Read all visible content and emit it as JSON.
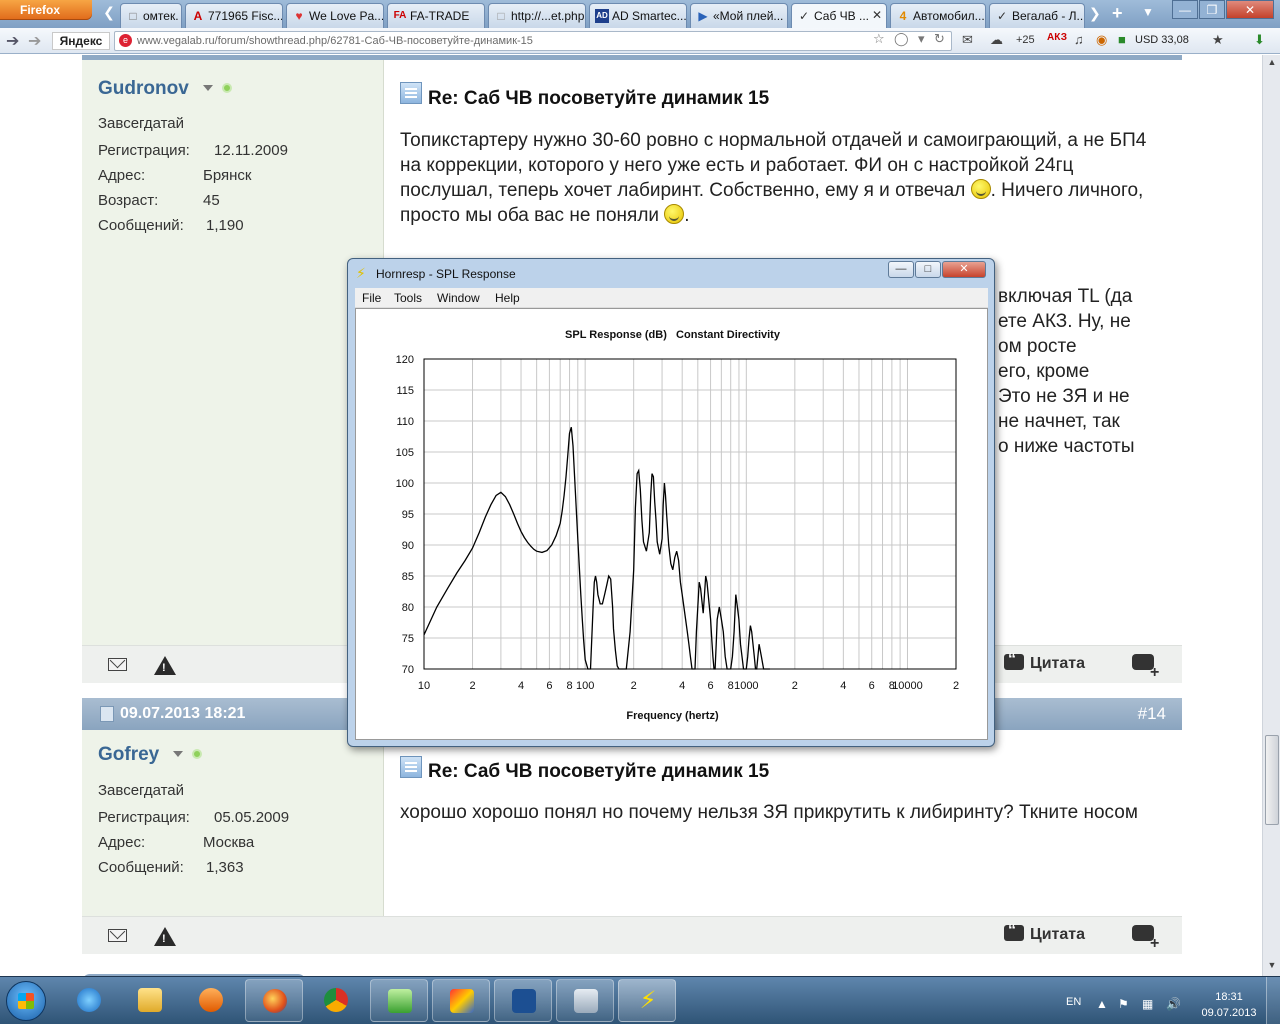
{
  "browser": {
    "firefox_label": "Firefox",
    "tabs": [
      {
        "label": "омтек. Ин...",
        "icon": "page-icon"
      },
      {
        "label": "771965 Fisc...",
        "icon": "letter-a-icon"
      },
      {
        "label": "We Love Pa...",
        "icon": "flame-icon"
      },
      {
        "label": "FA-TRADE",
        "icon": "fa-logo-icon"
      },
      {
        "label": "http://...et.php",
        "icon": "blank-page-icon"
      },
      {
        "label": "AD Smartec...",
        "icon": "ad-logo-icon"
      },
      {
        "label": "«Мой плей...",
        "icon": "play-icon"
      },
      {
        "label": "Саб ЧВ ...",
        "icon": "vega-icon"
      },
      {
        "label": "Автомобил...",
        "icon": "number-4-icon"
      },
      {
        "label": "Вегалаб - Л...",
        "icon": "vega-icon"
      }
    ],
    "yandex_label": "Яндекс",
    "url": "www.vegalab.ru/forum/showthread.php/62781-Саб-ЧВ-посоветуйте-динамик-15",
    "weather": "+25",
    "currency": "USD 33,08"
  },
  "posts": [
    {
      "username": "Gudronov",
      "usertitle": "Завсегдатай",
      "rows": [
        {
          "label": "Регистрация:",
          "value": "12.11.2009"
        },
        {
          "label": "Адрес:",
          "value": "Брянск"
        },
        {
          "label": "Возраст:",
          "value": "45"
        },
        {
          "label": "Сообщений:",
          "value": "1,190"
        }
      ],
      "title": "Re: Саб ЧВ посоветуйте динамик 15",
      "text1": "Топикстартеру нужно 30-60 ровно с нормальной отдачей и самоиграющий, а не БП4 на коррекции, которого у него уже есть и работает. ФИ он с настройкой 24гц послушал, теперь хочет лабиринт. Собственно, ему я и отвечал ",
      "text2": ". Ничего личного, просто мы оба вас не поняли ",
      "text3": ".",
      "partial_lines": [
        "включая TL (да",
        "ете АКЗ. Ну, не",
        "ом росте",
        "его, кроме",
        "Это не ЗЯ и не",
        "не начнет, так",
        "о ниже частоты"
      ],
      "quote_label": "Цитата"
    },
    {
      "date": "09.07.2013 18:21",
      "number": "#14",
      "username": "Gofrey",
      "usertitle": "Завсегдатай",
      "rows": [
        {
          "label": "Регистрация:",
          "value": "05.05.2009"
        },
        {
          "label": "Адрес:",
          "value": "Москва"
        },
        {
          "label": "Сообщений:",
          "value": "1,363"
        }
      ],
      "title": "Re: Саб ЧВ посоветуйте динамик 15",
      "text": "хорошо хорошо понял но почему нельзя ЗЯ прикрутить к либиринту? Ткните носом",
      "quote_label": "Цитата"
    }
  ],
  "hornresp": {
    "window_title": "Hornresp - SPL Response",
    "menu": [
      "File",
      "Tools",
      "Window",
      "Help"
    ],
    "chart_data": {
      "type": "line",
      "title": "SPL Response (dB)   Constant Directivity",
      "xlabel": "Frequency (hertz)",
      "ylabel": "",
      "xscale": "log",
      "xlim": [
        10,
        20000
      ],
      "ylim": [
        70,
        120
      ],
      "yticks": [
        70,
        75,
        80,
        85,
        90,
        95,
        100,
        105,
        110,
        115,
        120
      ],
      "xtick_labels": [
        {
          "value": 10,
          "label": "10"
        },
        {
          "value": 20,
          "label": "2"
        },
        {
          "value": 40,
          "label": "4"
        },
        {
          "value": 60,
          "label": "6"
        },
        {
          "value": 80,
          "label": "8"
        },
        {
          "value": 100,
          "label": "100"
        },
        {
          "value": 200,
          "label": "2"
        },
        {
          "value": 400,
          "label": "4"
        },
        {
          "value": 600,
          "label": "6"
        },
        {
          "value": 800,
          "label": "8"
        },
        {
          "value": 1000,
          "label": "1000"
        },
        {
          "value": 2000,
          "label": "2"
        },
        {
          "value": 4000,
          "label": "4"
        },
        {
          "value": 6000,
          "label": "6"
        },
        {
          "value": 8000,
          "label": "8"
        },
        {
          "value": 10000,
          "label": "10000"
        },
        {
          "value": 20000,
          "label": "2"
        }
      ],
      "grid": true,
      "series": [
        {
          "x": [
            10,
            12,
            14,
            16,
            18,
            20,
            22,
            24,
            26,
            28,
            30,
            32,
            34,
            36,
            38,
            40,
            42,
            44,
            46,
            48,
            50,
            54,
            58,
            62,
            66,
            70,
            72,
            74,
            76,
            78,
            80,
            82,
            84,
            86,
            88,
            90,
            92,
            94,
            96,
            98,
            100,
            104,
            108,
            110,
            112,
            114,
            116,
            118,
            120,
            124,
            128,
            132,
            136,
            140,
            144,
            148,
            150,
            154,
            158,
            162,
            166,
            170,
            175,
            180,
            190,
            200,
            205,
            210,
            215,
            220,
            225,
            230,
            240,
            250,
            255,
            260,
            265,
            270,
            275,
            280,
            290,
            300,
            305,
            310,
            315,
            320,
            330,
            340,
            350,
            360,
            370,
            380,
            390,
            400,
            410,
            420,
            430,
            440,
            450,
            460,
            470,
            480,
            490,
            500,
            510,
            520,
            530,
            540,
            550,
            560,
            570,
            580,
            590,
            600,
            610,
            620,
            630,
            640,
            650,
            660,
            680,
            700,
            720,
            740,
            760,
            780,
            800,
            820,
            840,
            860,
            880,
            900,
            920,
            940,
            960,
            980,
            1000,
            1020,
            1040,
            1060,
            1080,
            1100,
            1120,
            1140,
            1160,
            1180,
            1200,
            1240,
            1280,
            1320,
            1360,
            1400
          ],
          "y": [
            75.5,
            80,
            83,
            85.5,
            87.5,
            89.5,
            92,
            94.5,
            96.5,
            98,
            98.5,
            97.8,
            96.5,
            95,
            93.5,
            92.2,
            91.2,
            90.4,
            89.8,
            89.3,
            89,
            88.8,
            89.1,
            90,
            91.5,
            93.5,
            95.5,
            98,
            101,
            104.5,
            108,
            109,
            106,
            101,
            96,
            91,
            86.5,
            82,
            78,
            74.5,
            71.5,
            70,
            70,
            75,
            80,
            84,
            85,
            84,
            82,
            80.5,
            80.5,
            82,
            83.5,
            85,
            84.5,
            80,
            76.5,
            73,
            70.5,
            70,
            70,
            70,
            70,
            70,
            76,
            86,
            96,
            101.5,
            102,
            99,
            94,
            90.5,
            89,
            92,
            98,
            101.5,
            101,
            97,
            94,
            90.5,
            88.5,
            91,
            96.5,
            100,
            98,
            95,
            90,
            87,
            86,
            88,
            89,
            87.5,
            84,
            82,
            80,
            78,
            76,
            74,
            72,
            70,
            70,
            70,
            76,
            80,
            84,
            83,
            81,
            79,
            82,
            85,
            84,
            82,
            80,
            78,
            75,
            72,
            70,
            70,
            74,
            78,
            80,
            78,
            76,
            72,
            70,
            70,
            70,
            72,
            76,
            82,
            80,
            78,
            74,
            72,
            70,
            70,
            70,
            72,
            75,
            77,
            76,
            74,
            72,
            70,
            70,
            72,
            74,
            72,
            70,
            70,
            70,
            70
          ]
        }
      ]
    }
  },
  "taskbar": {
    "lang": "EN",
    "time": "18:31",
    "date": "09.07.2013"
  }
}
